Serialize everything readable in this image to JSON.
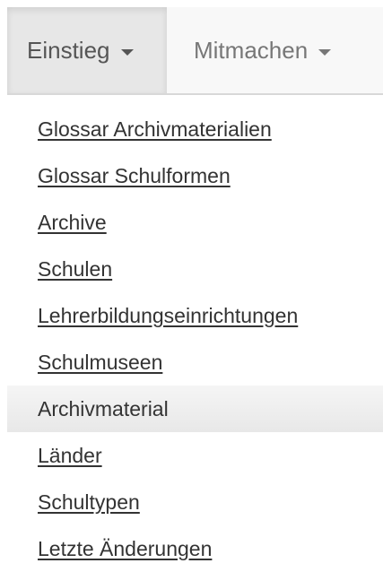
{
  "navbar": {
    "tabs": [
      {
        "label": "Einstieg",
        "active": true
      },
      {
        "label": "Mitmachen",
        "active": false
      }
    ]
  },
  "dropdown": {
    "items": [
      {
        "label": "Glossar Archivmaterialien"
      },
      {
        "label": "Glossar Schulformen"
      },
      {
        "label": "Archive"
      },
      {
        "label": "Schulen"
      },
      {
        "label": "Lehrerbildungseinrichtungen"
      },
      {
        "label": "Schulmuseen"
      },
      {
        "label": "Archivmaterial",
        "active": true
      },
      {
        "label": "Länder"
      },
      {
        "label": "Schultypen"
      },
      {
        "label": "Letzte Änderungen"
      }
    ]
  },
  "colors": {
    "navbar_bg": "#f8f8f8",
    "active_tab_bg": "#e7e7e7",
    "active_item_bg": "#ececec",
    "text": "#333333"
  }
}
